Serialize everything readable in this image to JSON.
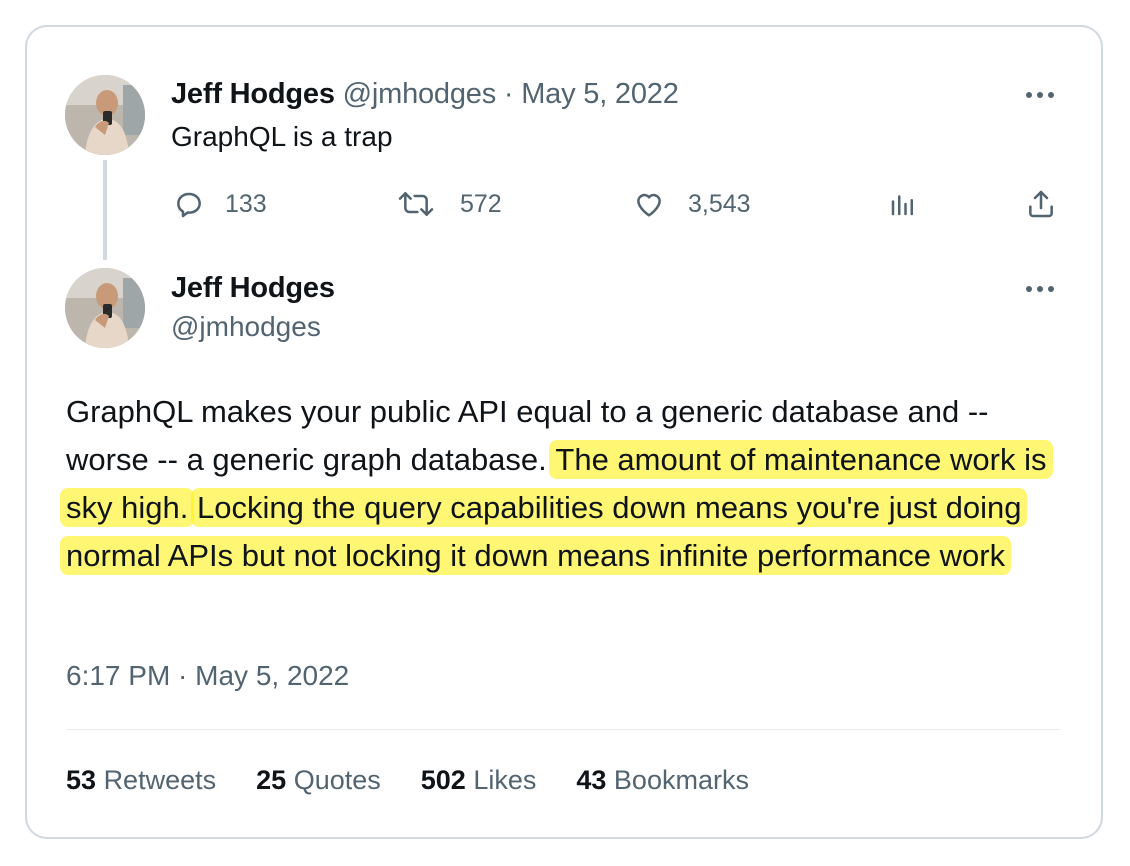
{
  "reply_tweet": {
    "author_name": "Jeff Hodges",
    "author_handle": "@jmhodges",
    "separator": "·",
    "date": "May 5, 2022",
    "text": "GraphQL is a trap",
    "actions": {
      "replies": "133",
      "retweets": "572",
      "likes": "3,543"
    }
  },
  "main_tweet": {
    "author_name": "Jeff Hodges",
    "author_handle": "@jmhodges",
    "text_plain": "GraphQL makes your public API equal to a generic database and -- worse -- a generic graph database.",
    "text_highlight_1": "The amount of maintenance work is sky high.",
    "text_highlight_2": "Locking the query capabilities down means you're just doing normal APIs but not locking it down means infinite performance work",
    "highlight_color": "#fff000",
    "timestamp": "6:17 PM · May 5, 2022",
    "stats": [
      {
        "count": "53",
        "label": "Retweets"
      },
      {
        "count": "25",
        "label": "Quotes"
      },
      {
        "count": "502",
        "label": "Likes"
      },
      {
        "count": "43",
        "label": "Bookmarks"
      }
    ]
  },
  "icons": [
    "avatar",
    "more-icon",
    "reply-icon",
    "retweet-icon",
    "like-icon",
    "views-icon",
    "share-icon"
  ]
}
